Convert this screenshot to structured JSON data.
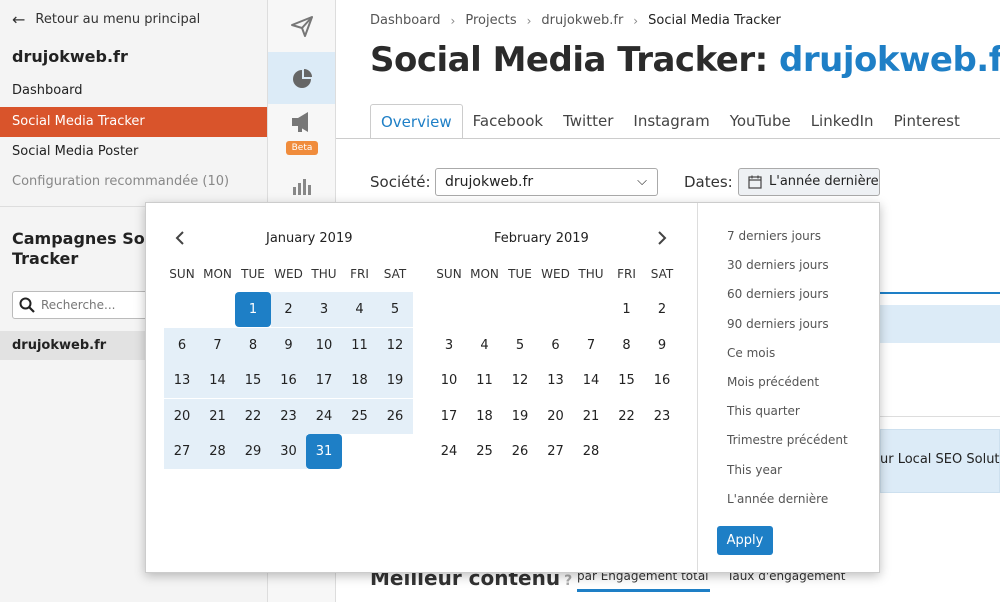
{
  "sidebar": {
    "back_label": "Retour au menu principal",
    "project": "drujokweb.fr",
    "items": [
      {
        "label": "Dashboard"
      },
      {
        "label": "Social Media Tracker"
      },
      {
        "label": "Social Media Poster"
      },
      {
        "label": "Configuration recommandée (10)"
      }
    ],
    "campaigns_title_line1": "Campagnes Soci",
    "campaigns_title_line2": "Tracker",
    "search_placeholder": "Recherche...",
    "campaign": "drujokweb.fr"
  },
  "rail": {
    "icons": [
      "send-icon",
      "pie-chart-icon",
      "megaphone-icon",
      "bar-chart-icon"
    ],
    "beta": "Beta"
  },
  "breadcrumb": {
    "items": [
      "Dashboard",
      "Projects",
      "drujokweb.fr",
      "Social Media Tracker"
    ]
  },
  "title": {
    "prefix": "Social Media Tracker: ",
    "domain": "drujokweb.fr"
  },
  "tabs": [
    "Overview",
    "Facebook",
    "Twitter",
    "Instagram",
    "YouTube",
    "LinkedIn",
    "Pinterest"
  ],
  "filters": {
    "company_label": "Société:",
    "company_value": "drujokweb.fr",
    "dates_label": "Dates:",
    "dates_value": "L'année dernière"
  },
  "background": {
    "row_text": "ur Local SEO Solution",
    "best_content": "Meilleur contenu",
    "sub1": "par Engagement total",
    "sub2": "Taux d'engagement"
  },
  "picker": {
    "weekdays": [
      "SUN",
      "MON",
      "TUE",
      "WED",
      "THU",
      "FRI",
      "SAT"
    ],
    "month1": {
      "title": "January 2019",
      "weeks": [
        [
          "",
          "",
          "1",
          "2",
          "3",
          "4",
          "5"
        ],
        [
          "6",
          "7",
          "8",
          "9",
          "10",
          "11",
          "12"
        ],
        [
          "13",
          "14",
          "15",
          "16",
          "17",
          "18",
          "19"
        ],
        [
          "20",
          "21",
          "22",
          "23",
          "24",
          "25",
          "26"
        ],
        [
          "27",
          "28",
          "29",
          "30",
          "31",
          "",
          ""
        ]
      ]
    },
    "month2": {
      "title": "February 2019",
      "weeks": [
        [
          "",
          "",
          "",
          "",
          "",
          "1",
          "2"
        ],
        [
          "3",
          "4",
          "5",
          "6",
          "7",
          "8",
          "9"
        ],
        [
          "10",
          "11",
          "12",
          "13",
          "14",
          "15",
          "16"
        ],
        [
          "17",
          "18",
          "19",
          "20",
          "21",
          "22",
          "23"
        ],
        [
          "24",
          "25",
          "26",
          "27",
          "28",
          "",
          ""
        ]
      ]
    },
    "selected_start": "1",
    "selected_end": "31",
    "presets": [
      "7 derniers jours",
      "30 derniers jours",
      "60 derniers jours",
      "90 derniers jours",
      "Ce mois",
      "Mois précédent",
      "This quarter",
      "Trimestre précédent",
      "This year",
      "L'année dernière"
    ],
    "apply": "Apply"
  },
  "colors": {
    "accent": "#1e7fc6",
    "active_nav": "#d9542b",
    "range": "#e4eff8",
    "beta": "#f08c3c"
  }
}
